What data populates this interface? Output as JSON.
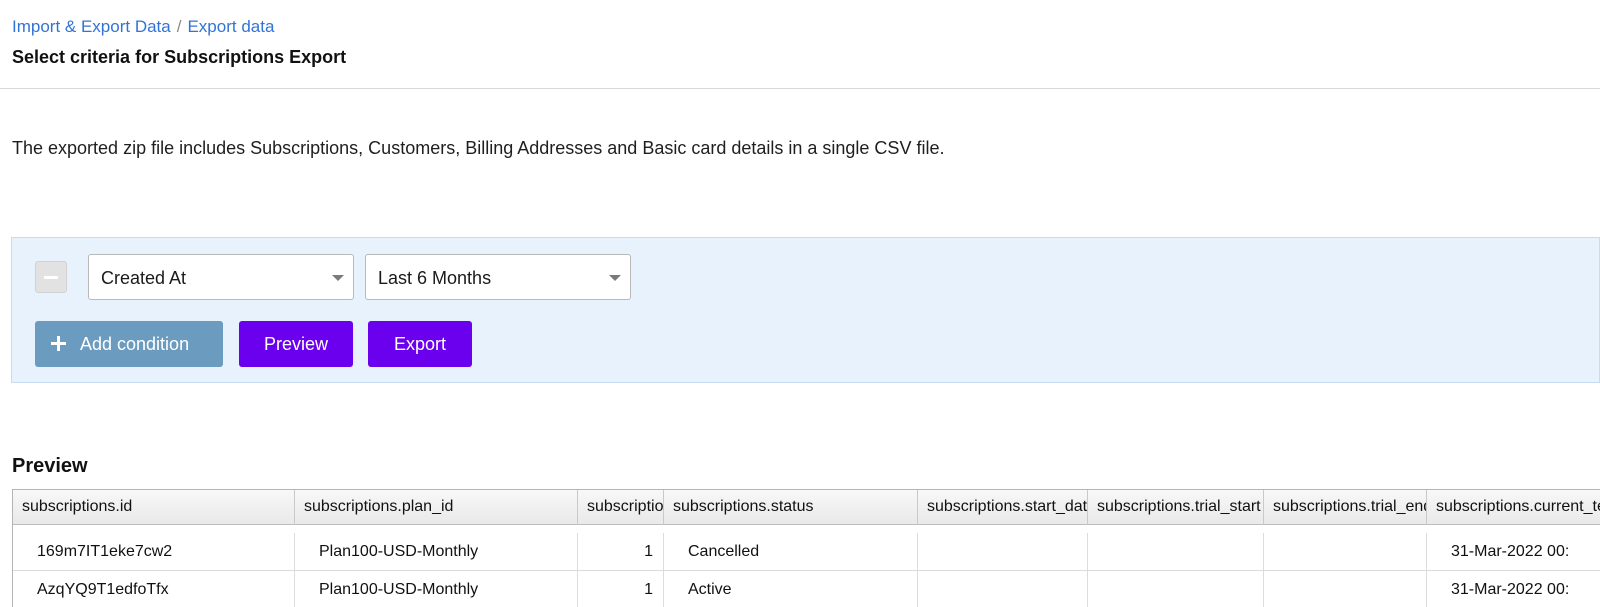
{
  "breadcrumb": {
    "parent": "Import & Export Data",
    "separator": "/",
    "current": "Export data"
  },
  "page_title": "Select criteria for Subscriptions Export",
  "description": "The exported zip file includes Subscriptions, Customers, Billing Addresses and Basic card details in a single CSV file.",
  "criteria": {
    "field_select": "Created At",
    "range_select": "Last 6 Months",
    "add_condition_label": "Add condition",
    "preview_label": "Preview",
    "export_label": "Export"
  },
  "preview": {
    "title": "Preview",
    "columns": [
      "subscriptions.id",
      "subscriptions.plan_id",
      "subscriptions.plan_quantity",
      "subscriptions.status",
      "subscriptions.start_date",
      "subscriptions.trial_start",
      "subscriptions.trial_end",
      "subscriptions.current_term_start"
    ],
    "rows": [
      [
        "169m7IT1eke7cw2",
        "Plan100-USD-Monthly",
        "1",
        "Cancelled",
        "",
        "",
        "",
        "31-Mar-2022 00:"
      ],
      [
        "AzqYQ9T1edfoTfx",
        "Plan100-USD-Monthly",
        "1",
        "Active",
        "",
        "",
        "",
        "31-Mar-2022 00:"
      ]
    ]
  },
  "colors": {
    "link": "#3273d6",
    "primary_button": "#6a00ee",
    "secondary_button": "#6b9bbf",
    "criteria_background": "#e8f2fc"
  }
}
